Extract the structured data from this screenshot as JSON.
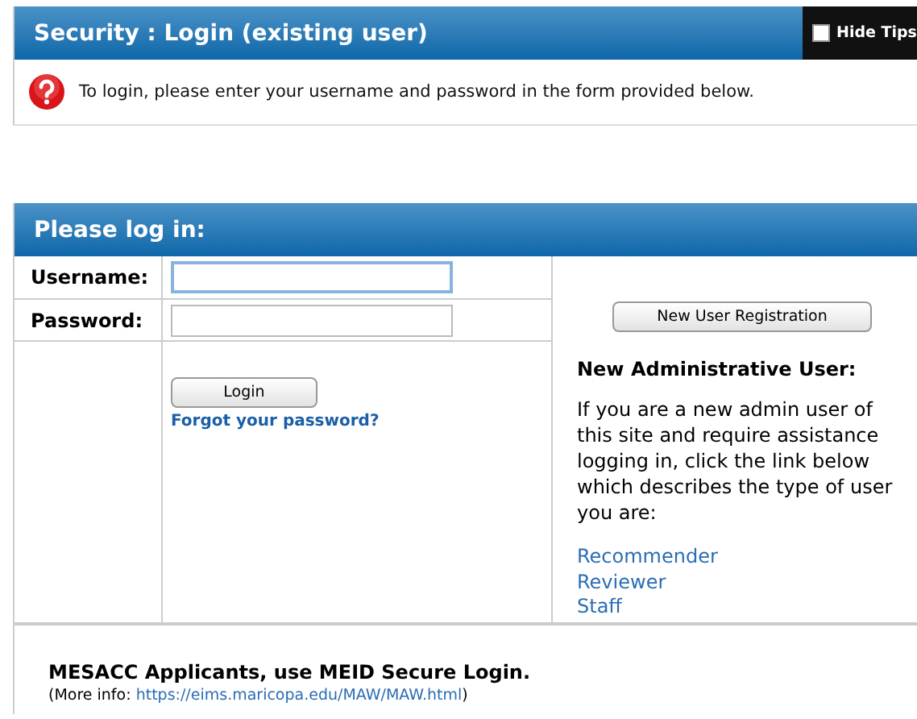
{
  "security_panel": {
    "title": "Security : Login (existing user)",
    "hide_tips": {
      "label": "Hide Tips",
      "checked": false
    },
    "tip": "To login, please enter your username and password in the form provided below."
  },
  "login_panel": {
    "title": "Please log in:",
    "fields": [
      {
        "label": "Username:",
        "focused": true
      },
      {
        "label": "Password:",
        "focused": false
      }
    ],
    "login_button": "Login",
    "forgot_link": "Forgot your password?",
    "registration_button": "New User Registration",
    "admin_heading": "New Administrative User:",
    "admin_text": "If you are a new admin user of this site and require assistance logging in, click the link below which describes the type of user you are:",
    "admin_links": [
      "Recommender",
      "Reviewer",
      "Staff"
    ],
    "footer_heading": "MESACC Applicants, use MEID Secure Login.",
    "footer_prefix": "(More info: ",
    "footer_link": "https://eims.maricopa.edu/MAW/MAW.html",
    "footer_suffix": ")"
  }
}
